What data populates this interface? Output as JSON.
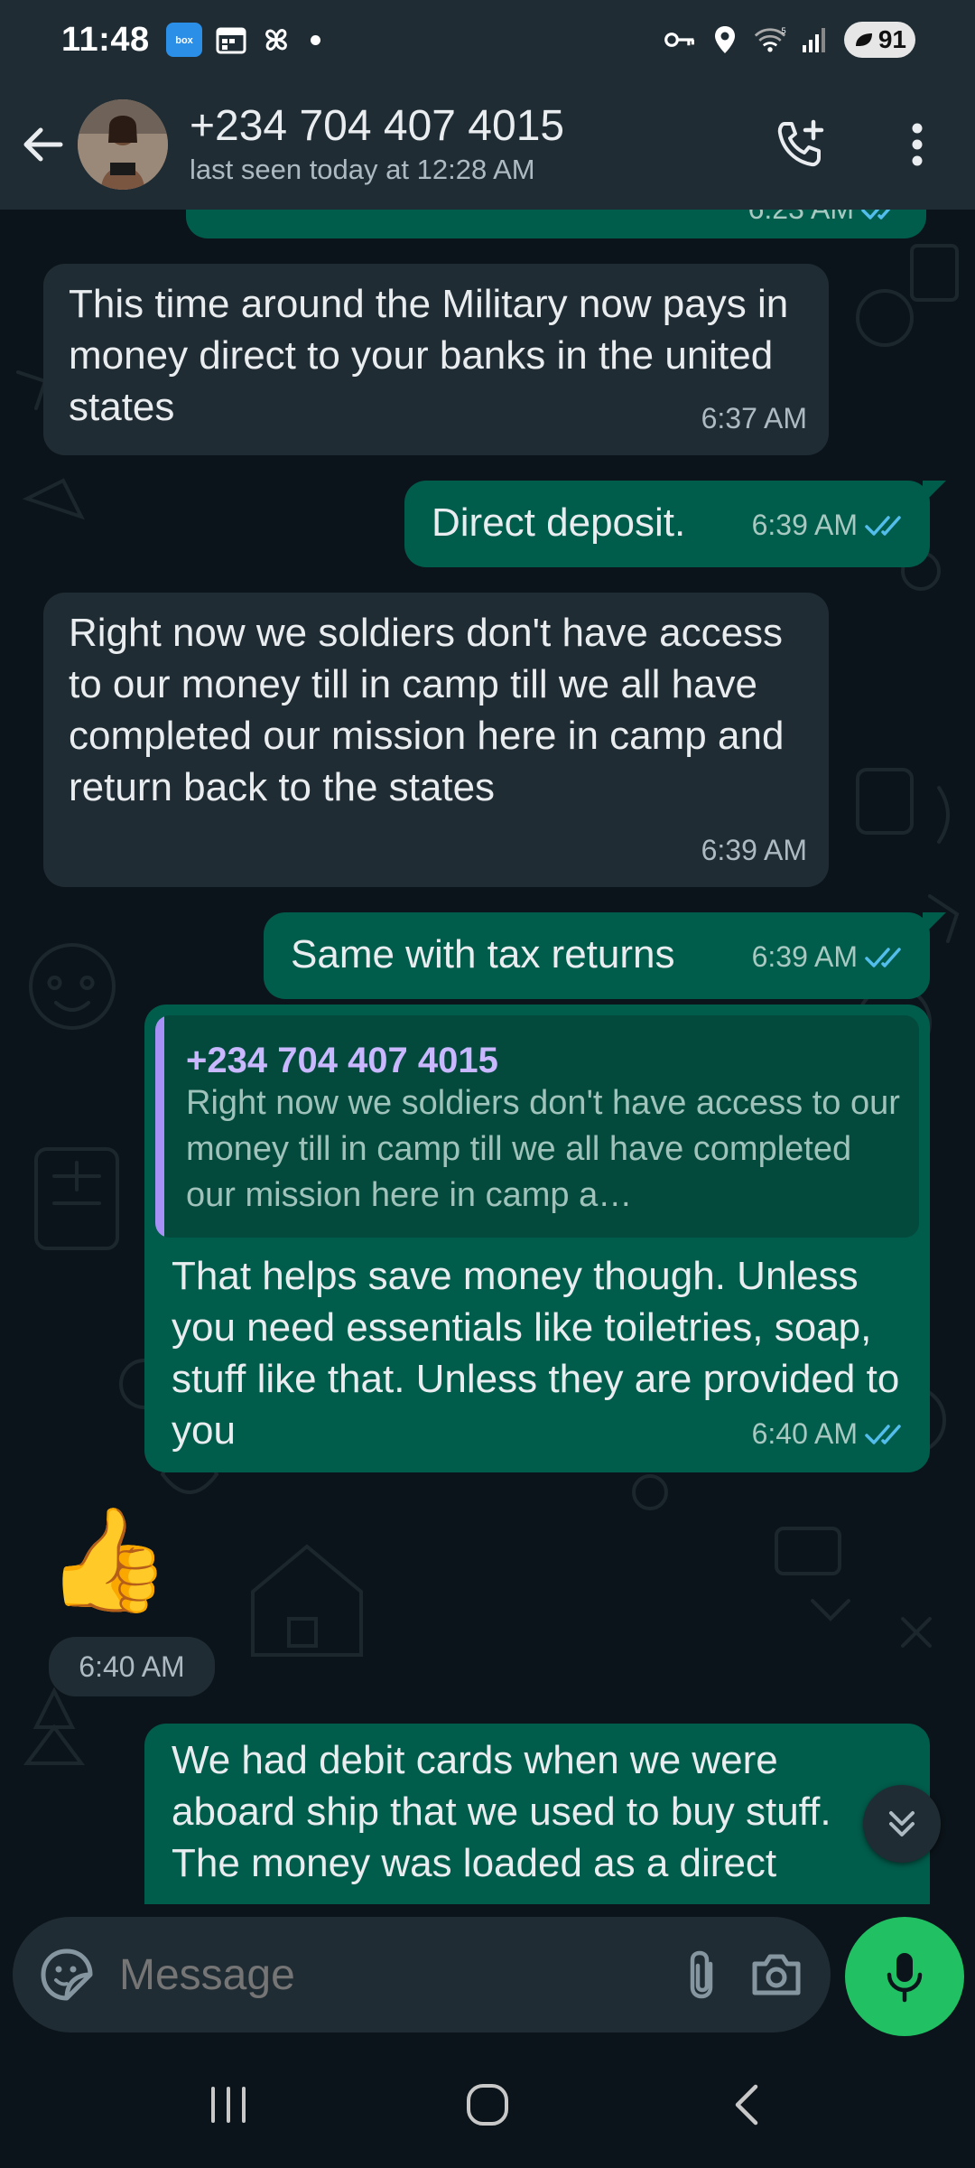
{
  "status_bar": {
    "time": "11:48",
    "battery": "91",
    "left_icons": [
      "box-app-icon",
      "calendar-icon",
      "pinwheel-icon",
      "dot-icon"
    ],
    "right_icons": [
      "key-icon",
      "location-icon",
      "wifi-icon",
      "signal-icon",
      "battery-icon"
    ]
  },
  "header": {
    "contact_name": "+234 704 407 4015",
    "last_seen": "last seen today at 12:28 AM"
  },
  "messages": [
    {
      "direction": "outgoing",
      "time": "6:23 AM",
      "partial": true
    },
    {
      "direction": "incoming",
      "text": "This time around the Military now pays in money direct to your banks in the united states",
      "time": "6:37 AM"
    },
    {
      "direction": "outgoing",
      "text": "Direct deposit.",
      "time": "6:39 AM",
      "read": true
    },
    {
      "direction": "incoming",
      "text": "Right now we soldiers don't have access to our money till in camp till we all have completed our mission here in camp and return back to the states",
      "time": "6:39 AM"
    },
    {
      "direction": "outgoing",
      "text": "Same with tax returns",
      "time": "6:39 AM",
      "read": true
    },
    {
      "direction": "outgoing",
      "quote": {
        "author": "+234 704 407 4015",
        "text": "Right now we soldiers don't have access to our money till in camp till we all have completed our mission here in camp a…"
      },
      "text": "That helps save money though. Unless you need essentials like toiletries, soap, stuff like that. Unless they are provided to you",
      "time": "6:40 AM",
      "read": true
    },
    {
      "direction": "incoming",
      "emoji": "👍",
      "time": "6:40 AM"
    },
    {
      "direction": "outgoing",
      "text": "We had debit cards when we were aboard ship that we used to buy stuff. The money was loaded as a direct",
      "partial": true
    }
  ],
  "composer": {
    "placeholder": "Message"
  },
  "colors": {
    "background": "#0b141a",
    "header": "#1f2c34",
    "incoming_bubble": "#202c33",
    "outgoing_bubble": "#005c4b",
    "read_ticks": "#53bdeb",
    "mic_button": "#21c063"
  }
}
